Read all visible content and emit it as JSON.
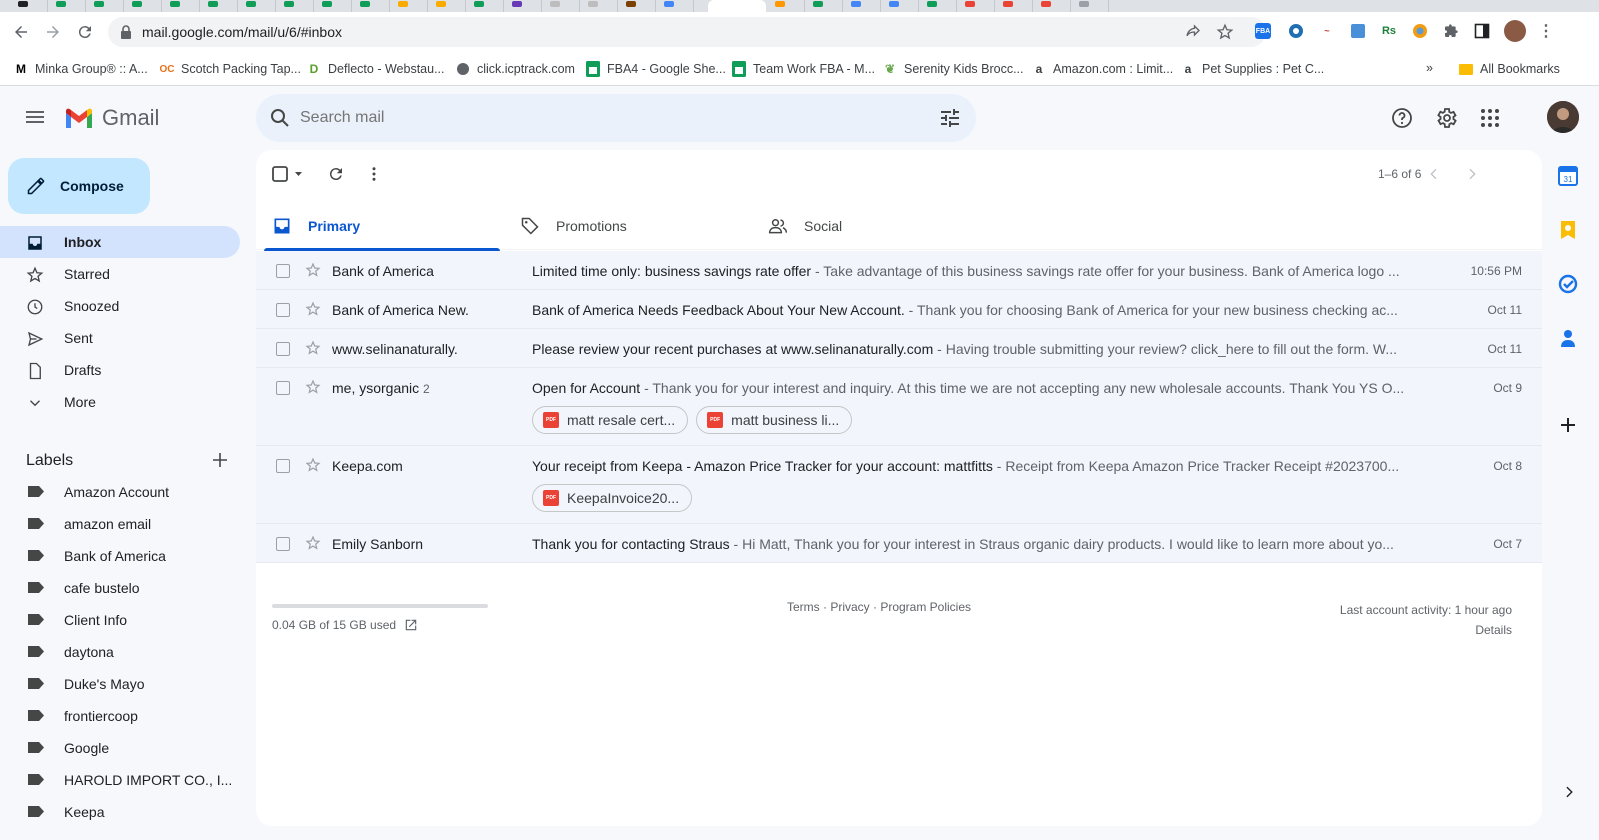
{
  "browser": {
    "url": "mail.google.com/mail/u/6/#inbox",
    "bookmarks": [
      {
        "label": "Minka Group® :: A...",
        "icon": "M"
      },
      {
        "label": "Scotch Packing Tap...",
        "icon": "OC"
      },
      {
        "label": "Deflecto - Webstau...",
        "icon": "D"
      },
      {
        "label": "click.icptrack.com",
        "icon": "globe"
      },
      {
        "label": "FBA4 - Google She...",
        "icon": "sheets"
      },
      {
        "label": "Team Work FBA - M...",
        "icon": "sheets"
      },
      {
        "label": "Serenity Kids Brocc...",
        "icon": "leaf"
      },
      {
        "label": "Amazon.com : Limit...",
        "icon": "a"
      },
      {
        "label": "Pet Supplies : Pet C...",
        "icon": "a"
      }
    ],
    "overflow": "»",
    "all_bookmarks": "All Bookmarks"
  },
  "gmail": {
    "brand": "Gmail",
    "search_placeholder": "Search mail",
    "compose": "Compose",
    "nav": [
      {
        "label": "Inbox",
        "icon": "inbox-icon",
        "active": true
      },
      {
        "label": "Starred",
        "icon": "star-icon"
      },
      {
        "label": "Snoozed",
        "icon": "clock-icon"
      },
      {
        "label": "Sent",
        "icon": "send-icon"
      },
      {
        "label": "Drafts",
        "icon": "draft-icon"
      },
      {
        "label": "More",
        "icon": "chevron-down-icon"
      }
    ],
    "labels_title": "Labels",
    "labels": [
      "Amazon Account",
      "amazon email",
      "Bank of America",
      "cafe bustelo",
      "Client Info",
      "daytona",
      "Duke's Mayo",
      "frontiercoop",
      "Google",
      "HAROLD IMPORT CO., I...",
      "Keepa"
    ],
    "pager": "1–6 of 6",
    "tabs": [
      {
        "label": "Primary",
        "icon": "inbox-icon",
        "active": true
      },
      {
        "label": "Promotions",
        "icon": "tag-icon"
      },
      {
        "label": "Social",
        "icon": "people-icon"
      }
    ],
    "emails": [
      {
        "from": "Bank of America",
        "count": "",
        "subject": "Limited time only: business savings rate offer",
        "snippet": " - Take advantage of this business savings rate offer for your business. Bank of America logo ...",
        "date": "10:56 PM",
        "attachments": []
      },
      {
        "from": "Bank of America New.",
        "count": "",
        "subject": "Bank of America Needs Feedback About Your New Account.",
        "snippet": " - Thank you for choosing Bank of America for your new business checking ac...",
        "date": "Oct 11",
        "attachments": []
      },
      {
        "from": "www.selinanaturally.",
        "count": "",
        "subject": "Please review your recent purchases at www.selinanaturally.com",
        "snippet": " - Having trouble submitting your review? click_here to fill out the form. W...",
        "date": "Oct 11",
        "attachments": []
      },
      {
        "from": "me, ysorganic",
        "count": "2",
        "subject": "Open for Account",
        "snippet": " - Thank you for your interest and inquiry. At this time we are not accepting any new wholesale accounts. Thank You YS O...",
        "date": "Oct 9",
        "attachments": [
          "matt resale cert...",
          "matt business li..."
        ]
      },
      {
        "from": "Keepa.com",
        "count": "",
        "subject": "Your receipt from Keepa - Amazon Price Tracker for your account: mattfitts",
        "snippet": " - Receipt from Keepa Amazon Price Tracker Receipt #2023700...",
        "date": "Oct 8",
        "attachments": [
          "KeepaInvoice20..."
        ]
      },
      {
        "from": "Emily Sanborn",
        "count": "",
        "subject": "Thank you for contacting Straus",
        "snippet": " - Hi Matt, Thank you for your interest in Straus organic dairy products. I would like to learn more about yo...",
        "date": "Oct 7",
        "attachments": []
      }
    ],
    "footer": {
      "storage": "0.04 GB of 15 GB used",
      "policies": "Terms · Privacy · Program Policies",
      "activity": "Last account activity: 1 hour ago",
      "details": "Details"
    }
  }
}
